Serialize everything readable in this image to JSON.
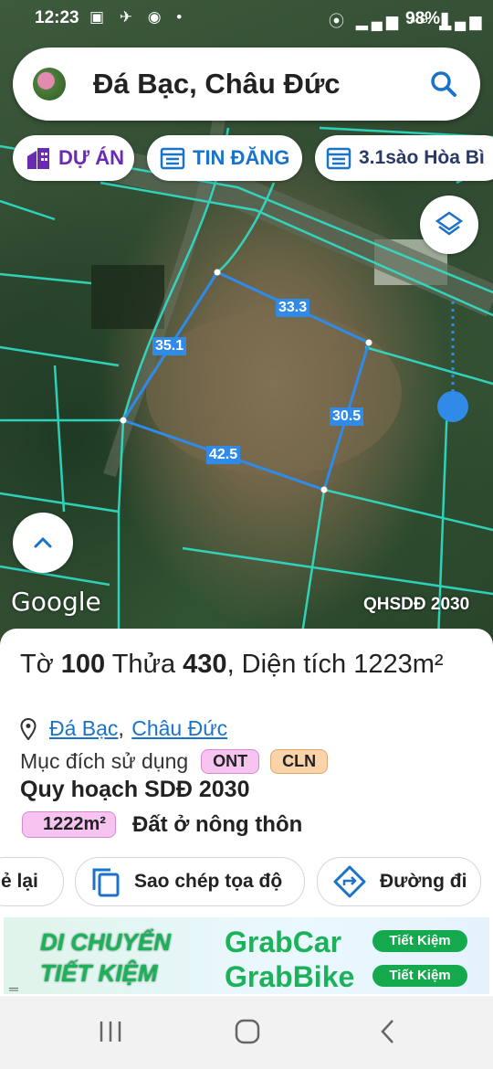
{
  "status_bar": {
    "time": "12:23",
    "left_icons": "▣ ✈ ◉ •",
    "right_icons": "⦿ ▂▄▆ ⁴ᴳ ▂▄▆",
    "battery": "98%▮"
  },
  "search": {
    "title": "Đá Bạc, Châu Đức",
    "icon": "search-icon"
  },
  "chips": [
    {
      "label": "DỰ ÁN",
      "icon": "building-icon"
    },
    {
      "label": "TIN ĐĂNG",
      "icon": "calendar-list-icon"
    },
    {
      "label": "3.1sào Hòa Bì",
      "icon": "calendar-list-icon"
    }
  ],
  "map": {
    "dimensions": [
      "33.3",
      "35.1",
      "30.5",
      "42.5"
    ],
    "google_logo": "Google",
    "badge": "QHSDĐ 2030"
  },
  "parcel": {
    "to_label": "Tờ ",
    "to_value": "100",
    "thua_label": " Thửa ",
    "thua_value": "430",
    "area_label": ", Diện tích ",
    "area_value": "1223m²",
    "commune": "Đá Bạc",
    "district": "Châu Đức",
    "purpose_label": "Mục đích sử dụng",
    "purpose_tags": [
      "ONT",
      "CLN"
    ],
    "plan_title": "Quy hoạch SDĐ 2030",
    "plan_area": "1222m²",
    "plan_desc": "Đất ở nông thôn"
  },
  "actions": {
    "back": "ẻ lại",
    "copy": "Sao chép tọa độ",
    "route": "Đường đi"
  },
  "ad": {
    "line1": "DI CHUYỂN",
    "line2": "TIẾT KIỆM",
    "brand1": "GrabCar",
    "brand2": "GrabBike",
    "pill1": "Tiết Kiệm",
    "pill2": "Tiết Kiệm",
    "menu": "═"
  },
  "colors": {
    "accent": "#1a73c8",
    "parcel_line": "#2f8ae8",
    "ont": "#f7c3f0",
    "cln": "#fbd3a8",
    "purple": "#6a2bb0"
  }
}
